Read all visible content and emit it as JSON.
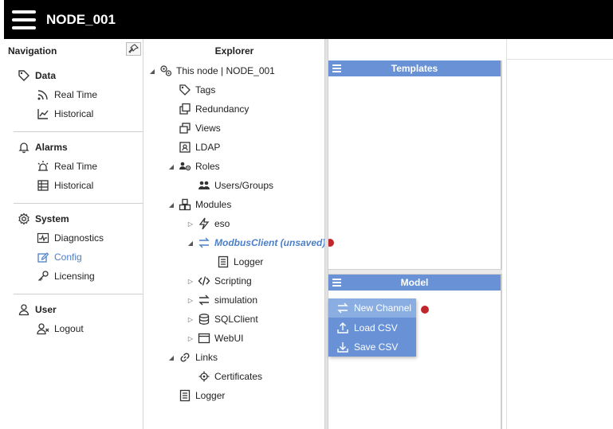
{
  "header": {
    "title": "NODE_001"
  },
  "navigation": {
    "title": "Navigation",
    "sections": [
      {
        "label": "Data",
        "icon": "tag-icon",
        "items": [
          {
            "label": "Real Time",
            "icon": "rss-icon"
          },
          {
            "label": "Historical",
            "icon": "line-chart-icon"
          }
        ]
      },
      {
        "label": "Alarms",
        "icon": "bell-icon",
        "items": [
          {
            "label": "Real Time",
            "icon": "siren-icon"
          },
          {
            "label": "Historical",
            "icon": "table-icon"
          }
        ]
      },
      {
        "label": "System",
        "icon": "gear-icon",
        "items": [
          {
            "label": "Diagnostics",
            "icon": "pulse-icon"
          },
          {
            "label": "Config",
            "icon": "edit-icon",
            "active": true
          },
          {
            "label": "Licensing",
            "icon": "key-icon"
          }
        ]
      },
      {
        "label": "User",
        "icon": "user-icon",
        "items": [
          {
            "label": "Logout",
            "icon": "user-x-icon"
          }
        ]
      }
    ]
  },
  "explorer": {
    "title": "Explorer",
    "tree": {
      "root": "This node | NODE_001",
      "tags": "Tags",
      "redundancy": "Redundancy",
      "views": "Views",
      "ldap": "LDAP",
      "roles": "Roles",
      "users_groups": "Users/Groups",
      "modules": "Modules",
      "eso": "eso",
      "modbus": "ModbusClient (unsaved)",
      "modbus_logger": "Logger",
      "scripting": "Scripting",
      "simulation": "simulation",
      "sqlclient": "SQLClient",
      "webui": "WebUI",
      "links": "Links",
      "certificates": "Certificates",
      "logger": "Logger"
    }
  },
  "templates_panel": {
    "title": "Templates"
  },
  "model_panel": {
    "title": "Model",
    "menu": [
      {
        "label": "New Channel",
        "icon": "swap-icon",
        "active": true
      },
      {
        "label": "Load CSV",
        "icon": "upload-icon"
      },
      {
        "label": "Save CSV",
        "icon": "download-icon"
      }
    ]
  },
  "colors": {
    "accent": "#6892d5",
    "unsaved": "#4b7fc8",
    "marker": "#c0272d",
    "header": "#000000"
  }
}
